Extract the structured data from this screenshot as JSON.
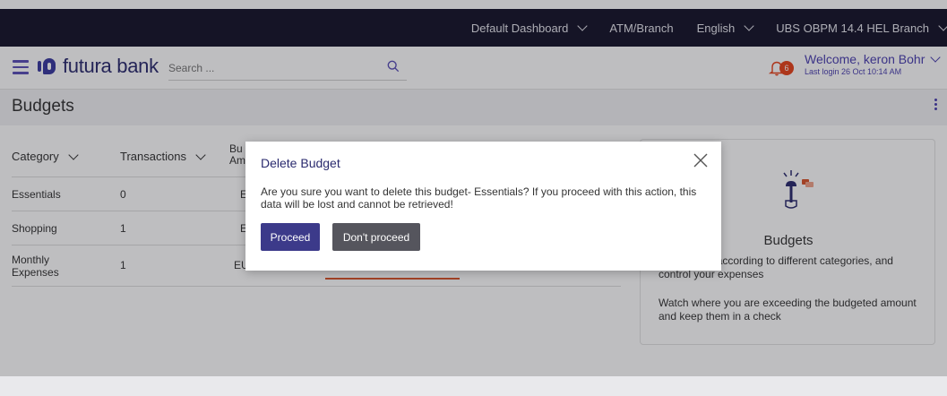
{
  "topbar": {
    "items": [
      {
        "label": "Default Dashboard",
        "has_chevron": true
      },
      {
        "label": "ATM/Branch",
        "has_chevron": false
      },
      {
        "label": "English",
        "has_chevron": true
      },
      {
        "label": "UBS OBPM 14.4 HEL Branch",
        "has_chevron": true
      }
    ]
  },
  "header": {
    "logo_text": "futura bank",
    "search_placeholder": "Search ...",
    "notification_count": "6",
    "welcome": "Welcome, keron Bohr",
    "last_login": "Last login 26 Oct 10:14 AM"
  },
  "page": {
    "title": "Budgets"
  },
  "table": {
    "headers": {
      "category": "Category",
      "transactions": "Transactions",
      "budget_amount_1": "Bu",
      "budget_amount_2": "Am"
    },
    "rows": [
      {
        "category": "Essentials",
        "transactions": "0",
        "amount": "E"
      },
      {
        "category": "Shopping",
        "transactions": "1",
        "amount": "E"
      },
      {
        "category": "Monthly Expenses",
        "transactions": "1",
        "amount": "EU"
      }
    ]
  },
  "card": {
    "title": "Budgets",
    "line1": "dic budgets according to different categories, and control your expenses",
    "line2": "Watch where you are exceeding the budgeted amount and keep them in a check"
  },
  "modal": {
    "title": "Delete Budget",
    "message": "Are you sure you want to delete this budget- Essentials? If you proceed with this action, this data will be lost and cannot be retrieved!",
    "proceed_label": "Proceed",
    "dont_proceed_label": "Don't proceed"
  },
  "colors": {
    "topbar_bg": "#15142a",
    "brand": "#3c3a8a",
    "secondary_button": "#55555d",
    "badge": "#e8431b",
    "progress": "#d8542a"
  }
}
